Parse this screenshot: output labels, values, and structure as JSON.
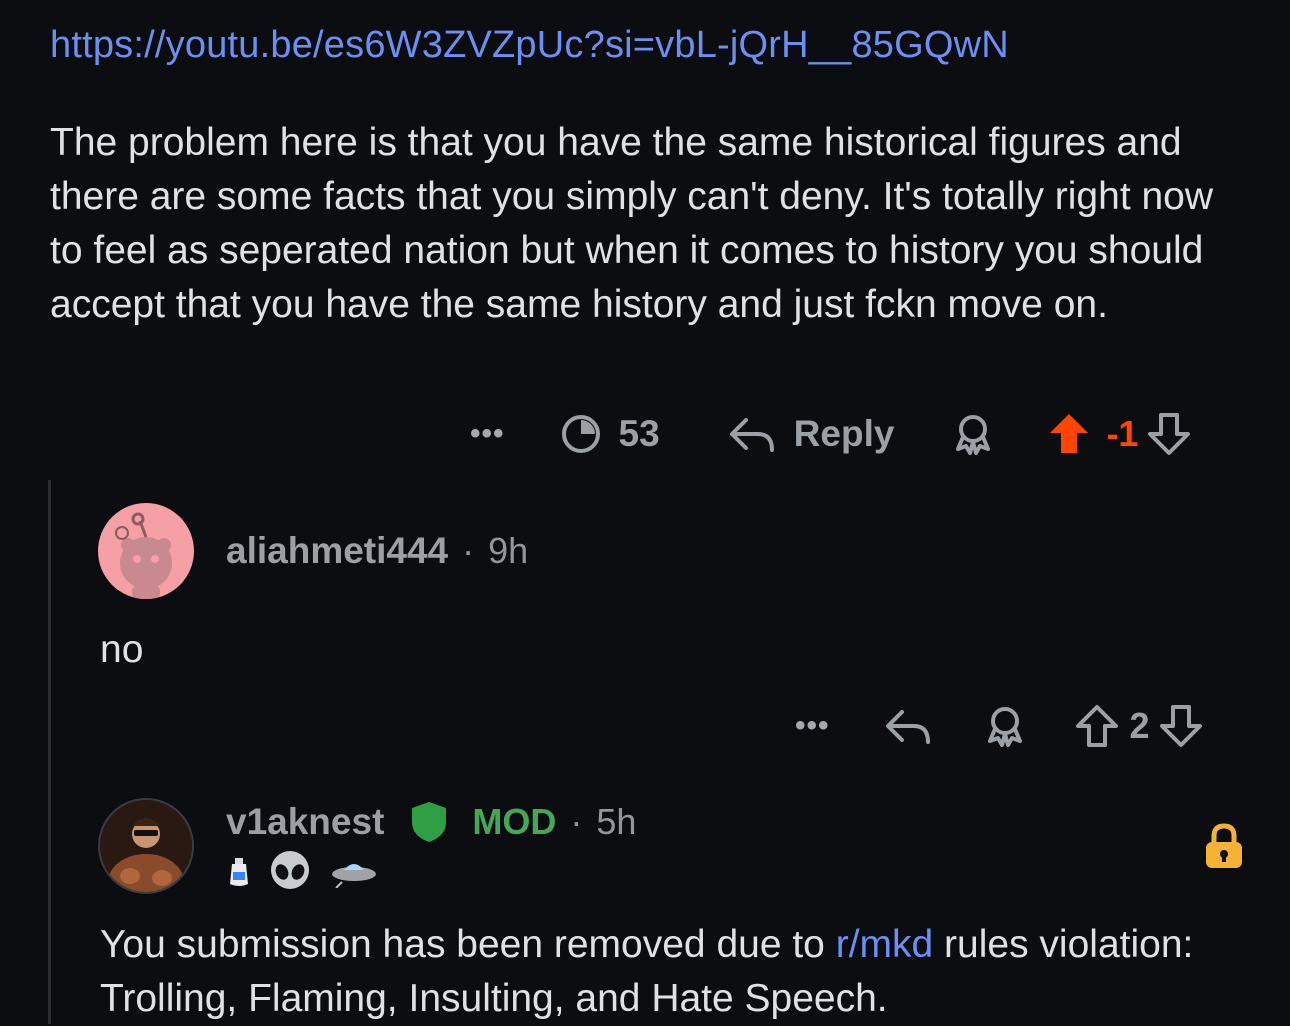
{
  "comment": {
    "link": "https://youtu.be/es6W3ZVZpUc?si=vbL-jQrH__85GQwN",
    "body": "The problem here is that you have the same historical figures and there are some facts that you simply can't deny. It's totally right now to feel as seperated nation but when it comes to history you should accept that you have the same history and just fckn move on.",
    "actions": {
      "more": "•••",
      "awards_count": "53",
      "reply_label": "Reply",
      "score": "-1"
    }
  },
  "reply1": {
    "username": "aliahmeti444",
    "separator": "·",
    "time": "9h",
    "body": "no",
    "actions": {
      "more": "•••",
      "score": "2"
    }
  },
  "reply2": {
    "username": "v1aknest",
    "mod_label": "MOD",
    "separator": "·",
    "time": "5h",
    "body_prefix": "You submission has been removed due to ",
    "subreddit": "r/mkd",
    "body_suffix": " rules violation: Trolling, Flaming, Insulting, and Hate Speech."
  },
  "colors": {
    "background": "#0c0d10",
    "link": "#6b8ff2",
    "upvote_active": "#ff4500",
    "mod_green": "#46a758",
    "lock_orange": "#f5b335"
  }
}
